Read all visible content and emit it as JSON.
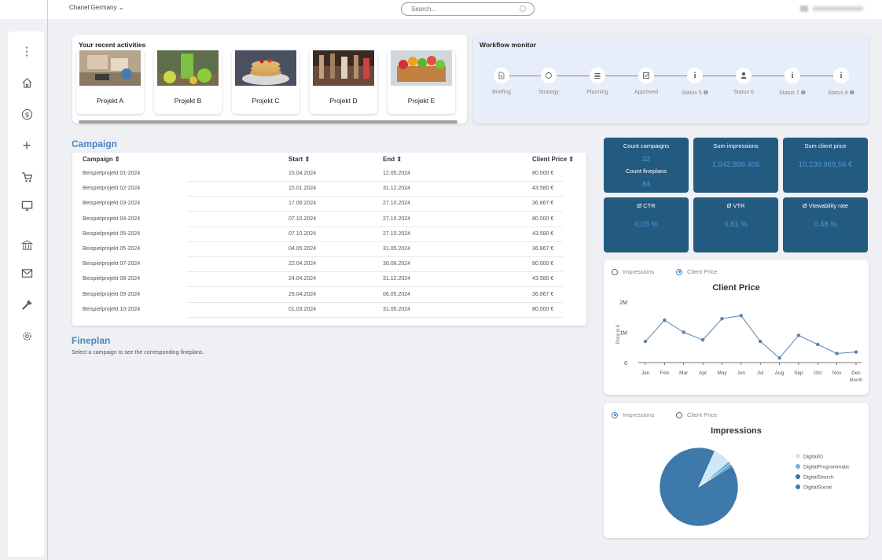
{
  "header": {
    "brand_selector": "Chanel Germany ⌄",
    "search_placeholder": "Search..."
  },
  "sidebar": {
    "items": [
      {
        "name": "more-icon",
        "glyph": "⋮"
      },
      {
        "name": "home-icon",
        "glyph": "⌂"
      },
      {
        "name": "dollar-icon",
        "glyph": "$"
      },
      {
        "name": "plus-icon",
        "glyph": "+"
      },
      {
        "name": "cart-icon",
        "glyph": "cart"
      },
      {
        "name": "monitor-icon",
        "glyph": "monitor"
      },
      {
        "name": "bank-icon",
        "glyph": "bank"
      },
      {
        "name": "mail-icon",
        "glyph": "mail"
      },
      {
        "name": "wrench-icon",
        "glyph": "wrench"
      },
      {
        "name": "gear-icon",
        "glyph": "gear"
      }
    ]
  },
  "recent": {
    "title": "Your recent activities",
    "projects": [
      {
        "label": "Projekt A"
      },
      {
        "label": "Projekt B"
      },
      {
        "label": "Projekt C"
      },
      {
        "label": "Projekt D"
      },
      {
        "label": "Projekt E"
      }
    ]
  },
  "workflow": {
    "title": "Workflow monitor",
    "steps": [
      {
        "label": "Briefing",
        "icon": "document-icon"
      },
      {
        "label": "Strategy",
        "icon": "circle-icon"
      },
      {
        "label": "Planning",
        "icon": "list-icon"
      },
      {
        "label": "Approved",
        "icon": "checkbox-icon"
      },
      {
        "label": "Status 5 ❶",
        "icon": "info-icon"
      },
      {
        "label": "Status 6",
        "icon": "user-icon"
      },
      {
        "label": "Status 7 ❶",
        "icon": "info-icon"
      },
      {
        "label": "Status 8 ❶",
        "icon": "info-icon"
      }
    ]
  },
  "campaign": {
    "heading": "Campaign",
    "columns": [
      "Campaign ⇕",
      "Start ⇕",
      "End ⇕",
      "Client Price ⇕"
    ],
    "rows": [
      [
        "Beispielprojekt 01-2024",
        "15.04.2024",
        "12.05.2024",
        "80.000 €"
      ],
      [
        "Beispielprojekt 02-2024",
        "15.01.2024",
        "31.12.2024",
        "43.580 €"
      ],
      [
        "Beispielprojekt 03-2024",
        "17.06.2024",
        "27.10.2024",
        "36.867 €"
      ],
      [
        "Beispielprojekt 04-2024",
        "07.10.2024",
        "27.10.2024",
        "80.000 €"
      ],
      [
        "Beispielprojekt 05-2024",
        "07.10.2024",
        "27.10.2024",
        "43.580 €"
      ],
      [
        "Beispielprojekt 05-2024",
        "04.05.2024",
        "31.05.2024",
        "36.867 €"
      ],
      [
        "Beispielprojekt 07-2024",
        "22.04.2024",
        "30.06.2024",
        "80.000 €"
      ],
      [
        "Beispielprojekt 08-2024",
        "24.04.2024",
        "31.12.2024",
        "43.580 €"
      ],
      [
        "Beispielprojekt 09-2024",
        "29.04.2024",
        "06.05.2024",
        "36.867 €"
      ],
      [
        "Beispielprojekt 10-2024",
        "01.03.2024",
        "31.05.2024",
        "80.000 €"
      ]
    ]
  },
  "fineplan": {
    "heading": "Fineplan",
    "hint": "Select a campaign to see the corresponding fineplans."
  },
  "kpis": {
    "count_campaigns_label": "Count campaigns",
    "count_campaigns_value": "32",
    "count_fineplans_label": "Count fineplans",
    "count_fineplans_value": "84",
    "sum_impressions_label": "Sum impressions",
    "sum_impressions_value": "1.042.899.405",
    "sum_client_price_label": "Sum client price",
    "sum_client_price_value": "10.230.969,56 €",
    "ctr_label": "Ø CTR",
    "ctr_value": "0,03 %",
    "vtr_label": "Ø VTR",
    "vtr_value": "0,61 %",
    "viewability_label": "Ø Viewability rate",
    "viewability_value": "0,48 %"
  },
  "chart_toggle": {
    "impressions": "Impressions",
    "client_price": "Client Price"
  },
  "chart_data": [
    {
      "type": "line",
      "title": "Client Price",
      "xlabel": "Month",
      "ylabel": "Price in €",
      "categories": [
        "Jan",
        "Feb",
        "Mar",
        "Apr",
        "May",
        "Jun",
        "Jul",
        "Aug",
        "Sep",
        "Oct",
        "Nov",
        "Dec"
      ],
      "yticks": [
        "0",
        "1M",
        "2M"
      ],
      "values": [
        700000,
        1400000,
        1000000,
        750000,
        1450000,
        1550000,
        700000,
        150000,
        900000,
        600000,
        300000,
        350000
      ],
      "ylim": [
        0,
        2000000
      ],
      "color": "#5a80a8"
    },
    {
      "type": "pie",
      "title": "Impressions",
      "legend_position": "right",
      "series": [
        {
          "name": "DigitalIO",
          "value": 7,
          "color": "#cde8f8"
        },
        {
          "name": "DigitalProgrammatic",
          "value": 1.5,
          "color": "#6cb4e4"
        },
        {
          "name": "DigitalSearch",
          "value": 0.8,
          "color": "#3a72a8"
        },
        {
          "name": "DigitalSocial",
          "value": 90.7,
          "color": "#3d7aab"
        }
      ]
    }
  ]
}
